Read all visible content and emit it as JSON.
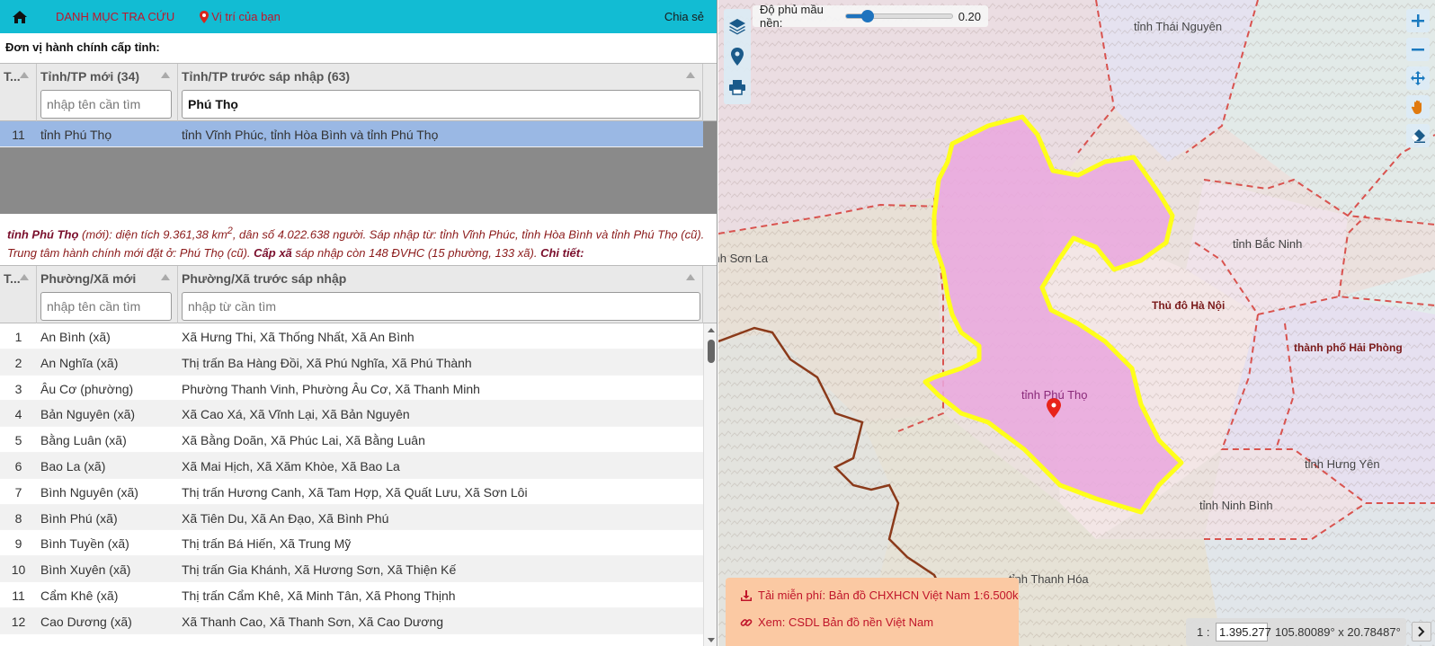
{
  "topbar": {
    "catalog": "DANH MỤC TRA CỨU",
    "location": "Vị trí của bạn",
    "share": "Chia sẻ"
  },
  "section_label": "Đơn vị hành chính cấp tỉnh:",
  "province_grid": {
    "columns": [
      "T...",
      "Tỉnh/TP mới (34)",
      "Tỉnh/TP trước sáp nhập (63)"
    ],
    "filter_new_placeholder": "nhập tên cần tìm",
    "filter_old_value": "Phú Thọ",
    "rows": [
      {
        "stt": "11",
        "new": "tỉnh Phú Thọ",
        "old": "tỉnh Vĩnh Phúc, tỉnh Hòa Bình và tỉnh Phú Thọ"
      }
    ]
  },
  "info": {
    "name": "tỉnh Phú Thọ",
    "t1": " (mới): diện tích 9.361,38 km",
    "sup": "2",
    "t2": ", dân số 4.022.638 người. Sáp nhập từ: tỉnh Vĩnh Phúc, tỉnh Hòa Bình và tỉnh Phú Thọ (cũ). Trung tâm hành chính mới đặt ở: Phú Thọ (cũ). ",
    "cap_xa": "Cấp xã",
    "t3": " sáp nhập còn 148 ĐVHC (15 phường, 133 xã). ",
    "chi_tiet": "Chi tiết:"
  },
  "commune_grid": {
    "columns": [
      "T...",
      "Phường/Xã mới",
      "Phường/Xã trước sáp nhập"
    ],
    "filter_new_placeholder": "nhập tên cần tìm",
    "filter_old_placeholder": "nhập từ cần tìm",
    "rows": [
      {
        "stt": "1",
        "new": "An Bình (xã)",
        "old": "Xã Hưng Thi, Xã Thống Nhất, Xã An Bình"
      },
      {
        "stt": "2",
        "new": "An Nghĩa (xã)",
        "old": "Thị trấn Ba Hàng Đồi, Xã Phú Nghĩa, Xã Phú Thành"
      },
      {
        "stt": "3",
        "new": "Âu Cơ (phường)",
        "old": "Phường Thanh Vinh, Phường Âu Cơ, Xã Thanh Minh"
      },
      {
        "stt": "4",
        "new": "Bản Nguyên (xã)",
        "old": "Xã Cao Xá, Xã Vĩnh Lại, Xã Bản Nguyên"
      },
      {
        "stt": "5",
        "new": "Bằng Luân (xã)",
        "old": "Xã Bằng Doãn, Xã Phúc Lai, Xã Bằng Luân"
      },
      {
        "stt": "6",
        "new": "Bao La (xã)",
        "old": "Xã Mai Hịch, Xã Xăm Khòe, Xã Bao La"
      },
      {
        "stt": "7",
        "new": "Bình Nguyên (xã)",
        "old": "Thị trấn Hương Canh, Xã Tam Hợp, Xã Quất Lưu, Xã Sơn Lôi"
      },
      {
        "stt": "8",
        "new": "Bình Phú (xã)",
        "old": "Xã Tiên Du, Xã An Đạo, Xã Bình Phú"
      },
      {
        "stt": "9",
        "new": "Bình Tuyền (xã)",
        "old": "Thị trấn Bá Hiến, Xã Trung Mỹ"
      },
      {
        "stt": "10",
        "new": "Bình Xuyên (xã)",
        "old": "Thị trấn Gia Khánh, Xã Hương Sơn, Xã Thiện Kế"
      },
      {
        "stt": "11",
        "new": "Cẩm Khê (xã)",
        "old": "Thị trấn Cẩm Khê, Xã Minh Tân, Xã Phong Thịnh"
      },
      {
        "stt": "12",
        "new": "Cao Dương (xã)",
        "old": "Xã Thanh Cao, Xã Thanh Sơn, Xã Cao Dương"
      }
    ]
  },
  "map": {
    "opacity_label": "Độ phủ mầu nền:",
    "opacity_value": "0.20",
    "opacity_fraction": 0.2,
    "labels": {
      "thai_nguyen": "tỉnh Thái Nguyên",
      "bac_ninh": "tỉnh Bắc Ninh",
      "son_la": "tỉnh Sơn La",
      "ha_noi": "Thủ đô Hà Nội",
      "hai_phong": "thành phố Hải Phòng",
      "phu_tho": "tỉnh Phú Thọ",
      "hung_yen": "tỉnh Hưng Yên",
      "ninh_binh": "tỉnh Ninh Bình",
      "thanh_hoa": "tỉnh Thanh Hóa"
    },
    "promo_download": "Tải miễn phí: Bản đồ CHXHCN Việt Nam 1:6.500k",
    "promo_view": "Xem: CSDL Bản đồ nền Việt Nam",
    "scale_prefix": "1 :",
    "scale_value": "1.395.277",
    "coords": "105.80089° x 20.78487°",
    "colors": {
      "topbar": "#12bcd3",
      "highlight_fill": "#e9a9de",
      "highlight_border": "#ffff1a",
      "selected_row": "#9ab8e4",
      "boundary": "#d9534f",
      "national_border": "#8b3a1a"
    }
  }
}
